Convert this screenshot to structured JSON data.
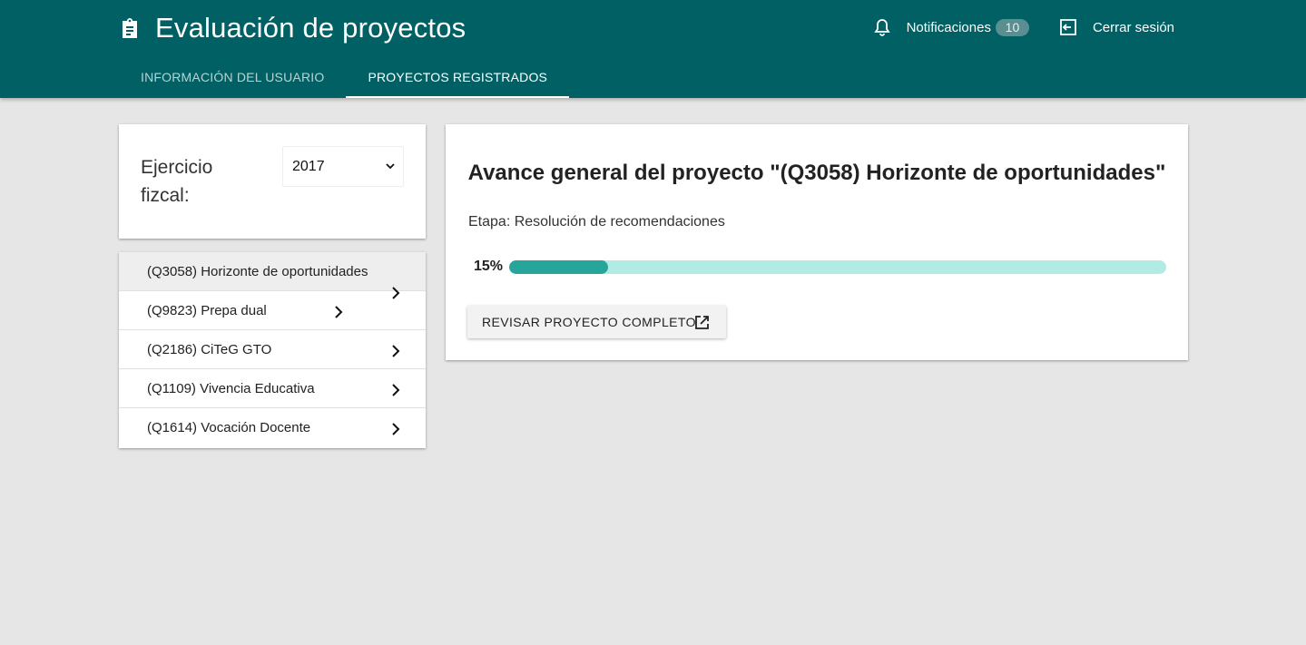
{
  "header": {
    "title": "Evaluación de proyectos",
    "title_icon": "clipboard-icon",
    "notifications_label": "Notificaciones",
    "notifications_count": "10",
    "logout_label": "Cerrar sesión"
  },
  "tabs": [
    {
      "label": "INFORMACIÓN DEL USUARIO",
      "active": false
    },
    {
      "label": "PROYECTOS REGISTRADOS",
      "active": true
    }
  ],
  "fiscal": {
    "label": "Ejercicio fizcal:",
    "selected_year": "2017"
  },
  "projects": [
    {
      "label": "(Q3058) Horizonte de oportunidades",
      "selected": true
    },
    {
      "label": "(Q9823) Prepa dual",
      "selected": false
    },
    {
      "label": "(Q2186) CiTeG GTO",
      "selected": false
    },
    {
      "label": "(Q1109) Vivencia Educativa",
      "selected": false
    },
    {
      "label": "(Q1614) Vocación Docente",
      "selected": false
    }
  ],
  "detail": {
    "title": "Avance general del proyecto \"(Q3058) Horizonte de oportunidades\"",
    "stage": "Etapa: Resolución de recomendaciones",
    "progress_label": "15%",
    "progress_value": 0.15,
    "review_button": "REVISAR PROYECTO COMPLETO"
  },
  "colors": {
    "appbar": "#006064",
    "progress_fill": "#26a69a",
    "progress_track": "#b2ebe4"
  }
}
